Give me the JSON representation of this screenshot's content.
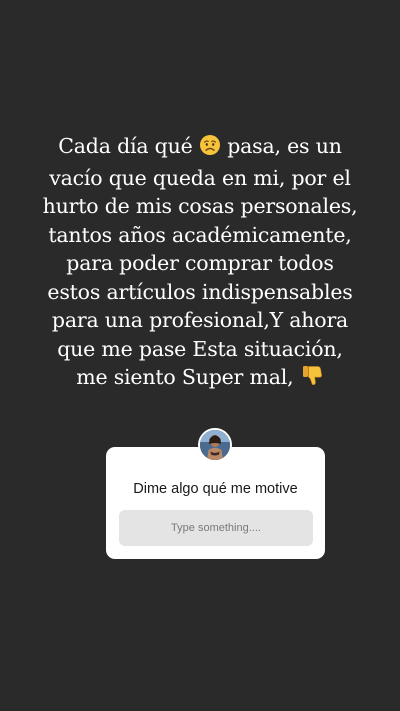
{
  "story": {
    "lines": [
      "Cada día qué",
      "pasa, es un",
      "vacío que queda en mi, por el",
      "hurto de mis cosas personales,",
      "tantos años académicamente,",
      "para poder comprar todos",
      "estos artículos indispensables",
      "para una profesional,Y ahora",
      "que me pase Esta situación,",
      "me siento Super mal,"
    ],
    "emojis": [
      "worried-face",
      "thumbs-down"
    ]
  },
  "question_sticker": {
    "prompt": "Dime algo qué me motive",
    "placeholder": "Type something...."
  },
  "colors": {
    "background": "#2a2a2a",
    "text": "#ffffff",
    "card": "#ffffff",
    "field": "#e4e4e4"
  }
}
